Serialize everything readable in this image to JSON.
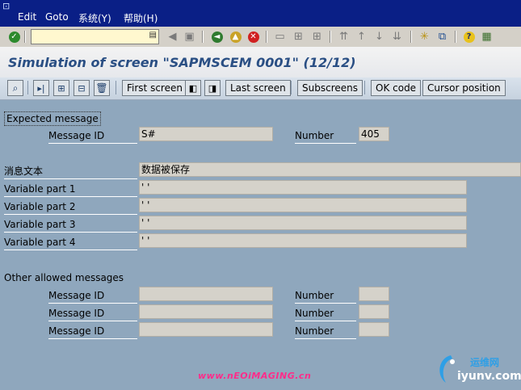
{
  "menu": {
    "items": [
      {
        "label": "Edit"
      },
      {
        "label": "Goto"
      },
      {
        "label": "系统(Y)"
      },
      {
        "label": "帮助(H)"
      }
    ]
  },
  "command_field": {
    "value": ""
  },
  "title": "Simulation of screen \"SAPMSCEM 0001\" (12/12)",
  "app_toolbar": {
    "first_screen": "First screen",
    "last_screen": "Last screen",
    "subscreens": "Subscreens",
    "ok_code": "OK code",
    "cursor_position": "Cursor position"
  },
  "expected": {
    "frame_label": "Expected message",
    "message_id_label": "Message ID",
    "message_id_value": "S#",
    "number_label": "Number",
    "number_value": "405",
    "message_text_label": "消息文本",
    "message_text_value": "数据被保存",
    "variables": [
      {
        "label": "Variable part 1",
        "value": "' '"
      },
      {
        "label": "Variable part 2",
        "value": "' '"
      },
      {
        "label": "Variable part 3",
        "value": "' '"
      },
      {
        "label": "Variable part 4",
        "value": "' '"
      }
    ]
  },
  "other": {
    "section_label": "Other allowed messages",
    "rows": [
      {
        "message_id_label": "Message ID",
        "message_id_value": "",
        "number_label": "Number",
        "number_value": ""
      },
      {
        "message_id_label": "Message ID",
        "message_id_value": "",
        "number_label": "Number",
        "number_value": ""
      },
      {
        "message_id_label": "Message ID",
        "message_id_value": "",
        "number_label": "Number",
        "number_value": ""
      }
    ]
  },
  "watermarks": {
    "left": "www.nEOiMAGING.cn",
    "right_top": "运维网",
    "right_bottom": "iyunv.com"
  },
  "colors": {
    "menubar": "#0a1f86",
    "background": "#8fa7bd",
    "title": "#2a4f84",
    "field": "#d5d2ca",
    "command_field": "#fff8cf"
  }
}
